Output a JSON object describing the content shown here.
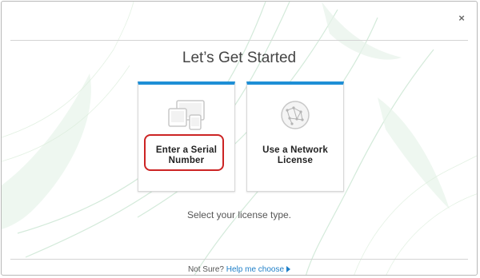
{
  "dialog": {
    "title": "Let’s Get Started",
    "close_symbol": "×",
    "subtitle": "Select your license type."
  },
  "options": [
    {
      "line1": "Enter a Serial",
      "line2": "Number",
      "icon": "devices-icon",
      "highlighted": true
    },
    {
      "line1": "Use a Network",
      "line2": "License",
      "icon": "network-globe-icon",
      "highlighted": false
    }
  ],
  "footer": {
    "prefix": "Not Sure?",
    "link": "Help me choose",
    "arrow_icon": "triangle-right-icon"
  },
  "colors": {
    "accent": "#1e8fd6",
    "highlight": "#cc2424",
    "link": "#1e7fc8"
  }
}
